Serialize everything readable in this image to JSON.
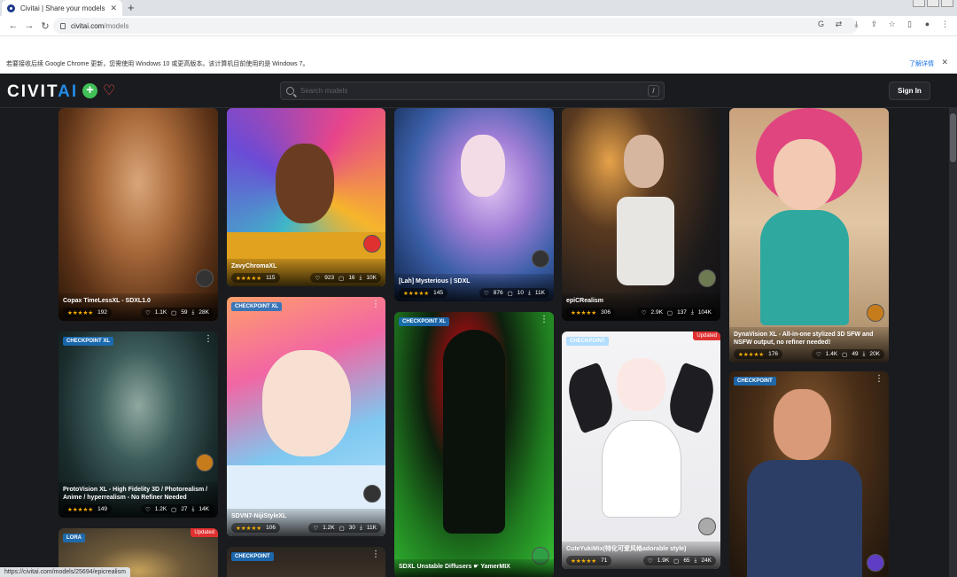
{
  "browser": {
    "tab_title": "Civitai | Share your models",
    "tab_close": "✕",
    "new_tab": "+",
    "url_host": "civitai.com",
    "url_path": "/models",
    "infobar_message": "若要接收后续 Google Chrome 更新，您需使用 Windows 10 或更高版本。该计算机目前使用的是 Windows 7。",
    "infobar_link": "了解详情",
    "status_url": "https://civitai.com/models/25694/epicrealism"
  },
  "site": {
    "logo_main": "CIVIT",
    "logo_ai": "AI",
    "search_placeholder": "Search models",
    "search_shortcut": "/",
    "signin_label": "Sign In",
    "brand_blue": "#228be6",
    "brand_green": "#40c057"
  },
  "cards": [
    {
      "name": "Copax TimeLessXL - SDXL1.0",
      "rating_count": "192",
      "likes": "1.1K",
      "comments": "59",
      "downloads": "28K",
      "stars": "★★★★★"
    },
    {
      "name": "ProtoVision XL - High Fidelity 3D / Photorealism / Anime / hyperrealism - No Refiner Needed",
      "badge": "CHECKPOINT XL",
      "rating_count": "149",
      "likes": "1.2K",
      "comments": "27",
      "downloads": "14K",
      "stars": "★★★★★"
    },
    {
      "badge": "LORA",
      "updated": "Updated"
    },
    {
      "name": "ZavyChromaXL",
      "rating_count": "115",
      "likes": "923",
      "comments": "16",
      "downloads": "10K",
      "stars": "★★★★★"
    },
    {
      "name": "SDVN7-NijiStyleXL",
      "badge": "CHECKPOINT XL",
      "rating_count": "106",
      "likes": "1.2K",
      "comments": "30",
      "downloads": "11K",
      "stars": "★★★★★"
    },
    {
      "badge": "CHECKPOINT"
    },
    {
      "name": "[Lah] Mysterious | SDXL",
      "rating_count": "145",
      "likes": "876",
      "comments": "10",
      "downloads": "11K",
      "stars": "★★★★★"
    },
    {
      "name": "SDXL Unstable Diffusers ☛ YamerMIX",
      "badge": "CHECKPOINT XL"
    },
    {
      "name": "epiCRealism",
      "rating_count": "306",
      "likes": "2.9K",
      "comments": "137",
      "downloads": "104K",
      "stars": "★★★★★"
    },
    {
      "name": "CuteYukiMix(特化可爱风格adorable style)",
      "badge": "CHECKPOINT",
      "updated": "Updated",
      "rating_count": "71",
      "likes": "1.9K",
      "comments": "65",
      "downloads": "24K",
      "stars": "★★★★★"
    },
    {
      "name": "DynaVision XL - All-in-one stylized 3D SFW and NSFW output, no refiner needed!",
      "rating_count": "176",
      "likes": "1.4K",
      "comments": "49",
      "downloads": "20K",
      "stars": "★★★★★"
    },
    {
      "badge": "CHECKPOINT"
    }
  ]
}
